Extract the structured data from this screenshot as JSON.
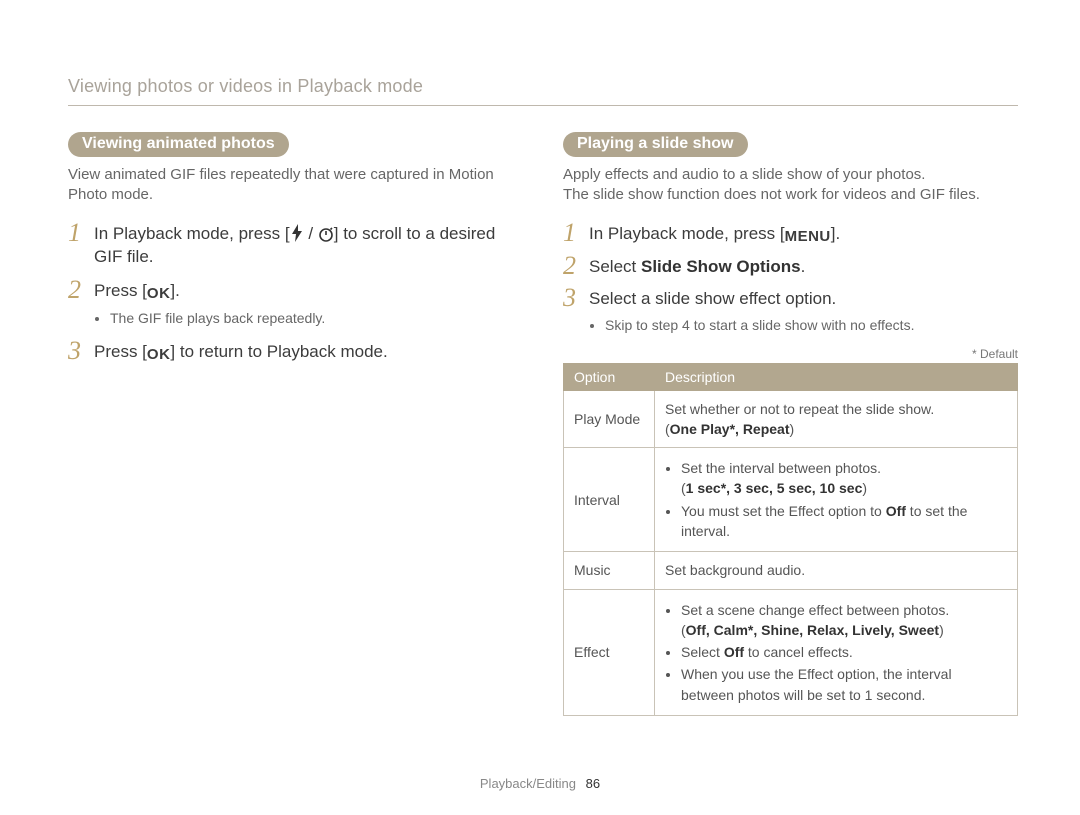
{
  "header": {
    "breadcrumb": "Viewing photos or videos in Playback mode"
  },
  "left": {
    "pill": "Viewing animated photos",
    "intro": "View animated GIF files repeatedly that were captured in Motion Photo mode.",
    "step1_a": "In Playback mode, press [",
    "step1_b": "] to scroll to a desired GIF file.",
    "step2_a": "Press [",
    "step2_b": "].",
    "step2_note": "The GIF file plays back repeatedly.",
    "step3_a": "Press [",
    "step3_b": "] to return to Playback mode."
  },
  "right": {
    "pill": "Playing a slide show",
    "intro_line1": "Apply effects and audio to a slide show of your photos.",
    "intro_line2": "The slide show function does not work for videos and GIF files.",
    "step1_a": "In Playback mode, press [",
    "step1_b": "].",
    "step2_a": "Select ",
    "step2_bold": "Slide Show Options",
    "step2_b": ".",
    "step3": "Select a slide show effect option.",
    "step3_note": "Skip to step 4 to start a slide show with no effects.",
    "default_label": "* Default",
    "table": {
      "head_option": "Option",
      "head_desc": "Description",
      "playmode": {
        "name": "Play Mode",
        "desc": "Set whether or not to repeat the slide show.",
        "opts": "One Play*, Repeat"
      },
      "interval": {
        "name": "Interval",
        "b1": "Set the interval between photos.",
        "opts": "1 sec*, 3 sec, 5 sec, 10 sec",
        "b2a": "You must set the Effect option to ",
        "b2bold": "Off",
        "b2b": " to set the interval."
      },
      "music": {
        "name": "Music",
        "desc": "Set background audio."
      },
      "effect": {
        "name": "Effect",
        "b1": "Set a scene change effect between photos.",
        "opts": "Off, Calm*, Shine, Relax, Lively, Sweet",
        "b2a": "Select ",
        "b2bold": "Off",
        "b2b": " to cancel effects.",
        "b3": "When you use the Effect option, the interval between photos will be set to 1 second."
      }
    }
  },
  "icons": {
    "ok": "OK",
    "menu": "MENU",
    "flash": "flash-icon",
    "timer": "timer-icon",
    "slash": "/"
  },
  "footer": {
    "section": "Playback/Editing",
    "page": "86"
  }
}
